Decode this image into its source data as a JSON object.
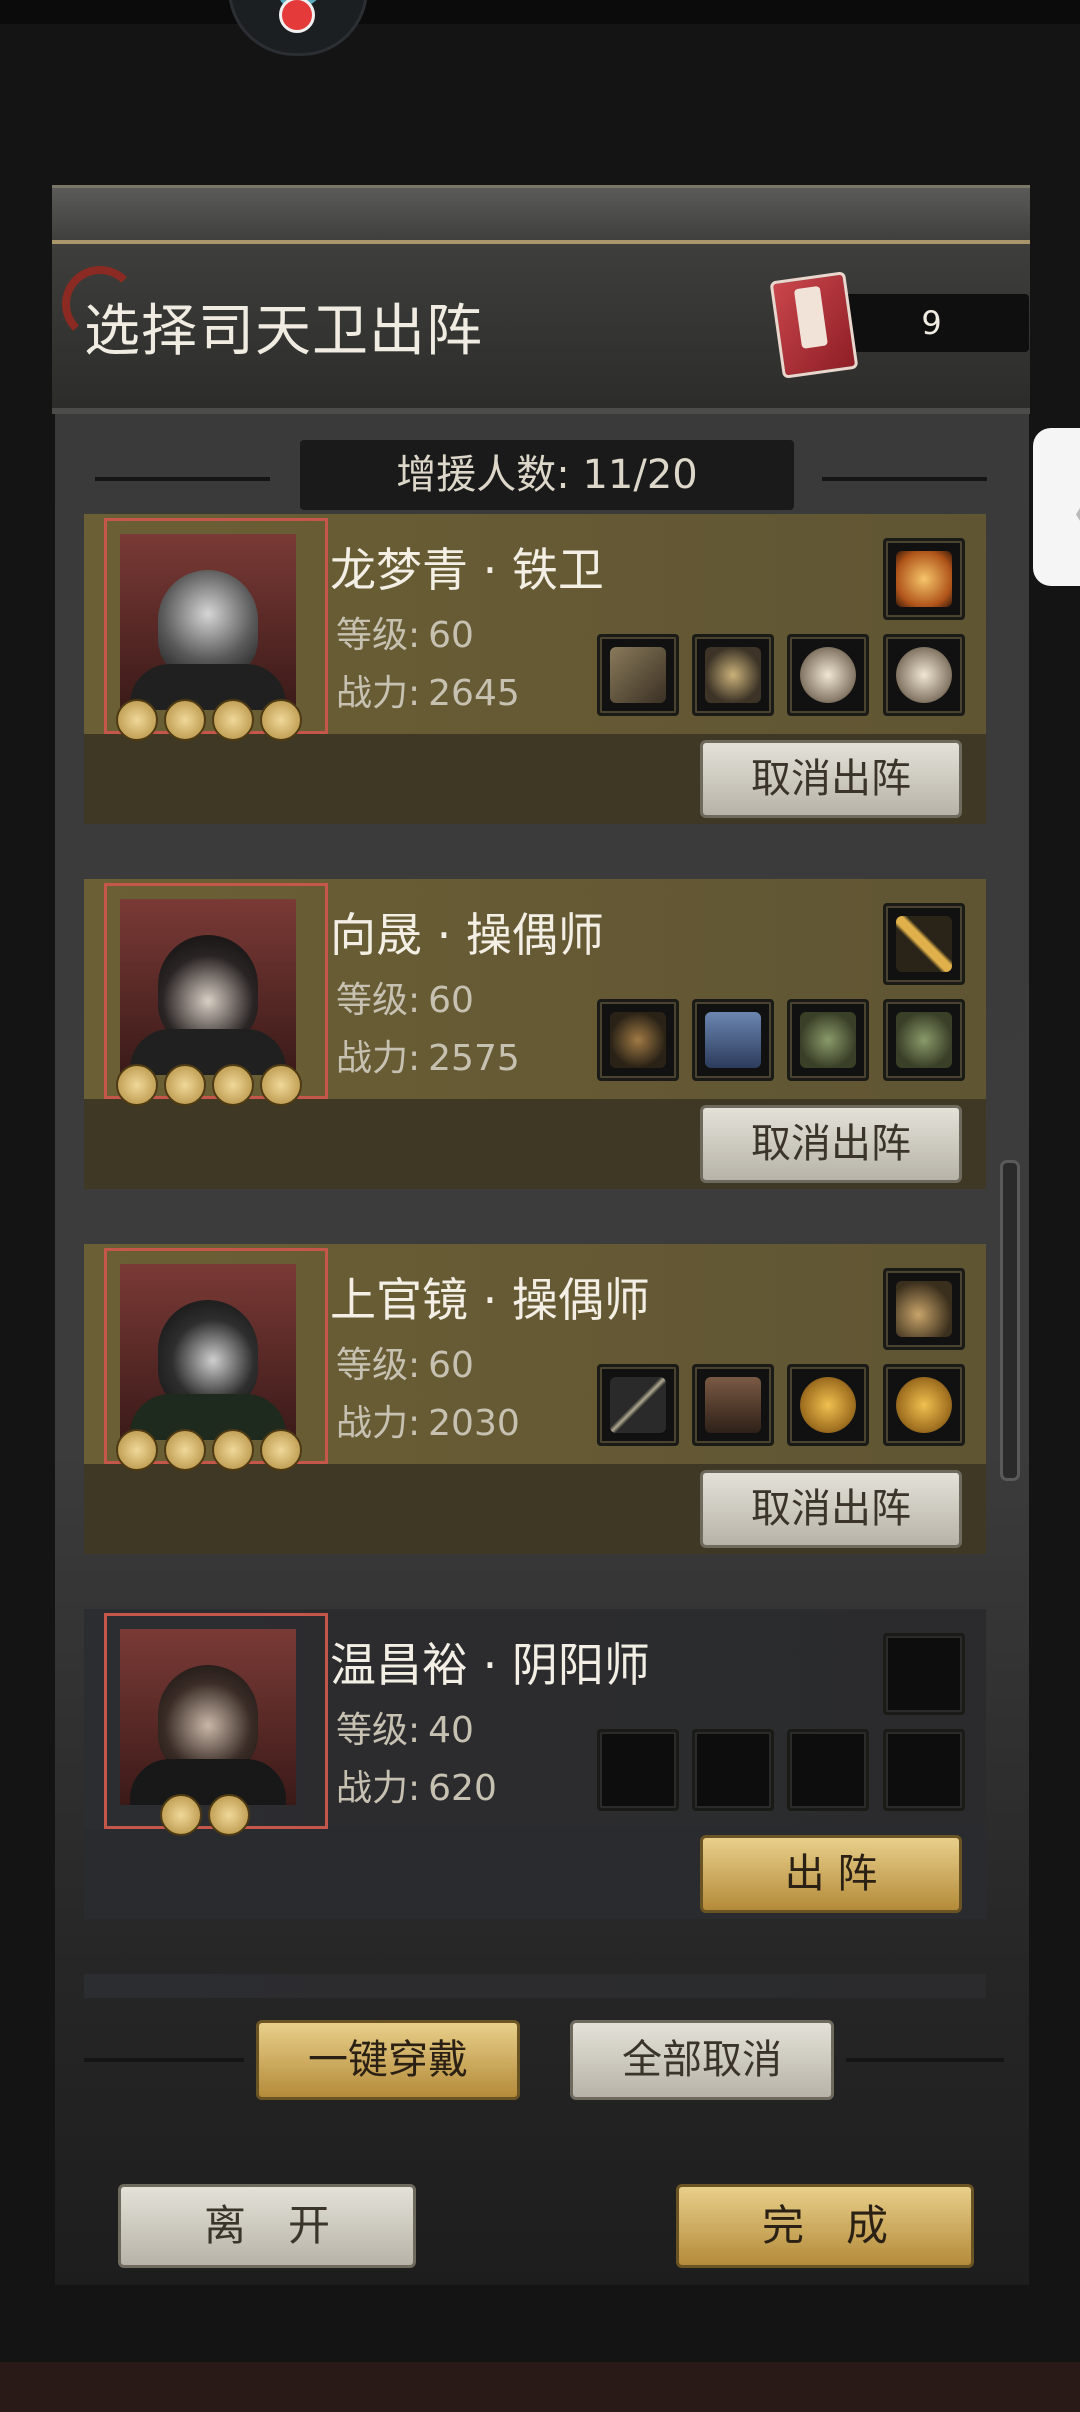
{
  "header": {
    "title": "选择司天卫出阵",
    "token_count": "9"
  },
  "reinforce": {
    "label": "增援人数: 11/20"
  },
  "heroes": [
    {
      "name": "龙梦青 · 铁卫",
      "level_label": "等级:",
      "level": "60",
      "power_label": "战力:",
      "power": "2645",
      "stars": 4,
      "equipped": true,
      "action": "取消出阵",
      "slot_icons": [
        "amber-orb-icon",
        "hammer-icon",
        "spiked-armor-icon",
        "skull-icon",
        "skull-icon"
      ]
    },
    {
      "name": "向晟 · 操偶师",
      "level_label": "等级:",
      "level": "60",
      "power_label": "战力:",
      "power": "2575",
      "stars": 4,
      "equipped": true,
      "action": "取消出阵",
      "slot_icons": [
        "golden-staff-icon",
        "crossbow-icon",
        "blue-robe-icon",
        "jade-toad-icon",
        "jade-toad-icon"
      ]
    },
    {
      "name": "上官镜 · 操偶师",
      "level_label": "等级:",
      "level": "60",
      "power_label": "战力:",
      "power": "2030",
      "stars": 4,
      "equipped": true,
      "action": "取消出阵",
      "slot_icons": [
        "feather-icon",
        "bow-icon",
        "leather-coat-icon",
        "gold-coin-icon",
        "gold-coin-icon"
      ]
    },
    {
      "name": "温昌裕 · 阴阳师",
      "level_label": "等级:",
      "level": "40",
      "power_label": "战力:",
      "power": "620",
      "stars": 2,
      "equipped": false,
      "action": "出 阵",
      "slot_icons": [
        "empty-slot-icon",
        "empty-slot-icon",
        "empty-slot-icon",
        "empty-slot-icon",
        "empty-slot-icon"
      ]
    }
  ],
  "footer": {
    "equip_all": "一键穿戴",
    "cancel_all": "全部取消",
    "leave": "离　开",
    "done": "完　成"
  },
  "colors": {
    "accent_gold": "#c9a95a",
    "panel_bg": "#3b3b3b",
    "active_card": "#635833",
    "inactive_card": "#2c2d30"
  }
}
